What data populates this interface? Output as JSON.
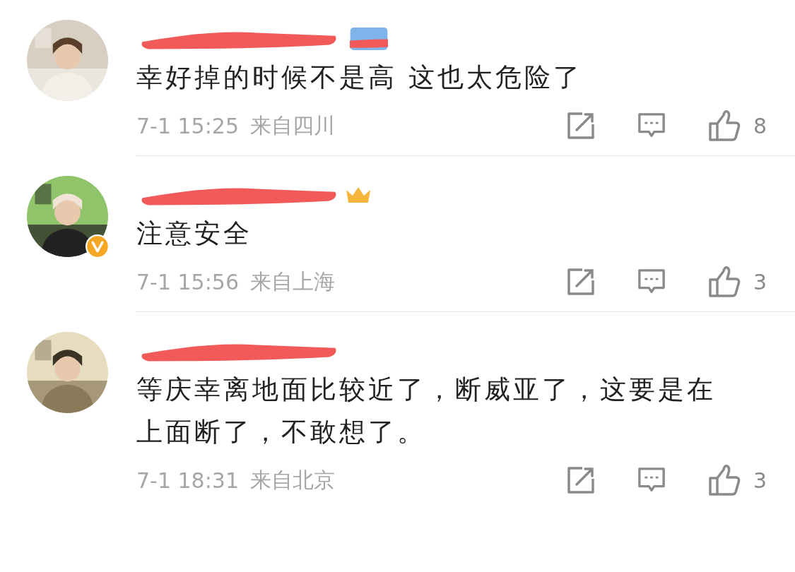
{
  "comments": [
    {
      "avatar": {
        "kind": "picture",
        "verified": false
      },
      "badge": {
        "kind": "fan"
      },
      "text": "幸好掉的时候不是高 这也太危险了",
      "time": "7-1 15:25",
      "location": "来自四川",
      "likes": "8"
    },
    {
      "avatar": {
        "kind": "picture",
        "verified": true
      },
      "badge": {
        "kind": "crown"
      },
      "text": "注意安全",
      "time": "7-1 15:56",
      "location": "来自上海",
      "likes": "3"
    },
    {
      "avatar": {
        "kind": "picture",
        "verified": false
      },
      "text": "等庆幸离地面比较近了，断威亚了，这要是在上面断了，不敢想了。",
      "time": "7-1 18:31",
      "location": "来自北京",
      "likes": "3"
    }
  ]
}
